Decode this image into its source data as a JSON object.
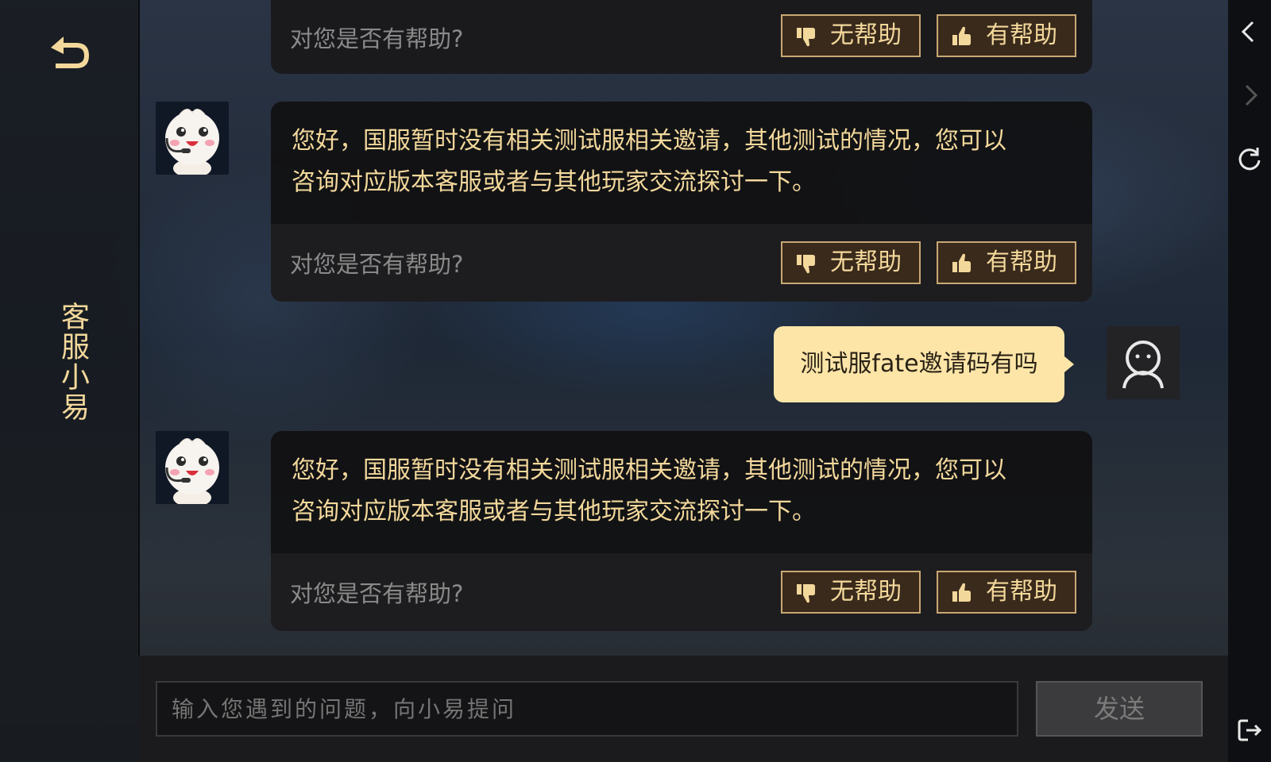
{
  "sidebar": {
    "title": "客服小易",
    "back_icon": "back-arrow-icon"
  },
  "rail": {
    "icons": [
      "chevron-left-icon",
      "chevron-right-icon",
      "refresh-icon",
      "exit-icon"
    ]
  },
  "feedback": {
    "question": "对您是否有帮助?",
    "no_label": "无帮助",
    "yes_label": "有帮助"
  },
  "messages": [
    {
      "from": "bot",
      "line1": "您好，国服暂时没有相关测试服相关邀请，其他测试的情况，您可以",
      "line2": "咨询对应版本客服或者与其他玩家交流探讨一下。"
    },
    {
      "from": "user",
      "text": "测试服fate邀请码有吗"
    },
    {
      "from": "bot",
      "line1": "您好，国服暂时没有相关测试服相关邀请，其他测试的情况，您可以",
      "line2": "咨询对应版本客服或者与其他玩家交流探讨一下。"
    }
  ],
  "input": {
    "placeholder": "输入您遇到的问题，向小易提问",
    "send_label": "发送"
  },
  "colors": {
    "accent_gold": "#f3d89b",
    "button_border": "#c9a774",
    "user_bubble": "#fde5a8"
  }
}
